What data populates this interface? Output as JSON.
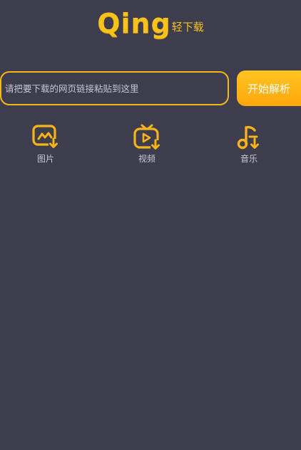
{
  "app": {
    "logo_word": "Qing",
    "logo_sub": "轻下载"
  },
  "search": {
    "placeholder": "请把要下载的网页链接粘贴到这里",
    "button_label": "开始解析"
  },
  "categories": [
    {
      "label": "图片",
      "icon": "image-download-icon"
    },
    {
      "label": "视频",
      "icon": "tv-play-download-icon"
    },
    {
      "label": "音乐",
      "icon": "music-download-icon"
    }
  ],
  "colors": {
    "background": "#3d3d4e",
    "accent": "#f7b41a"
  }
}
